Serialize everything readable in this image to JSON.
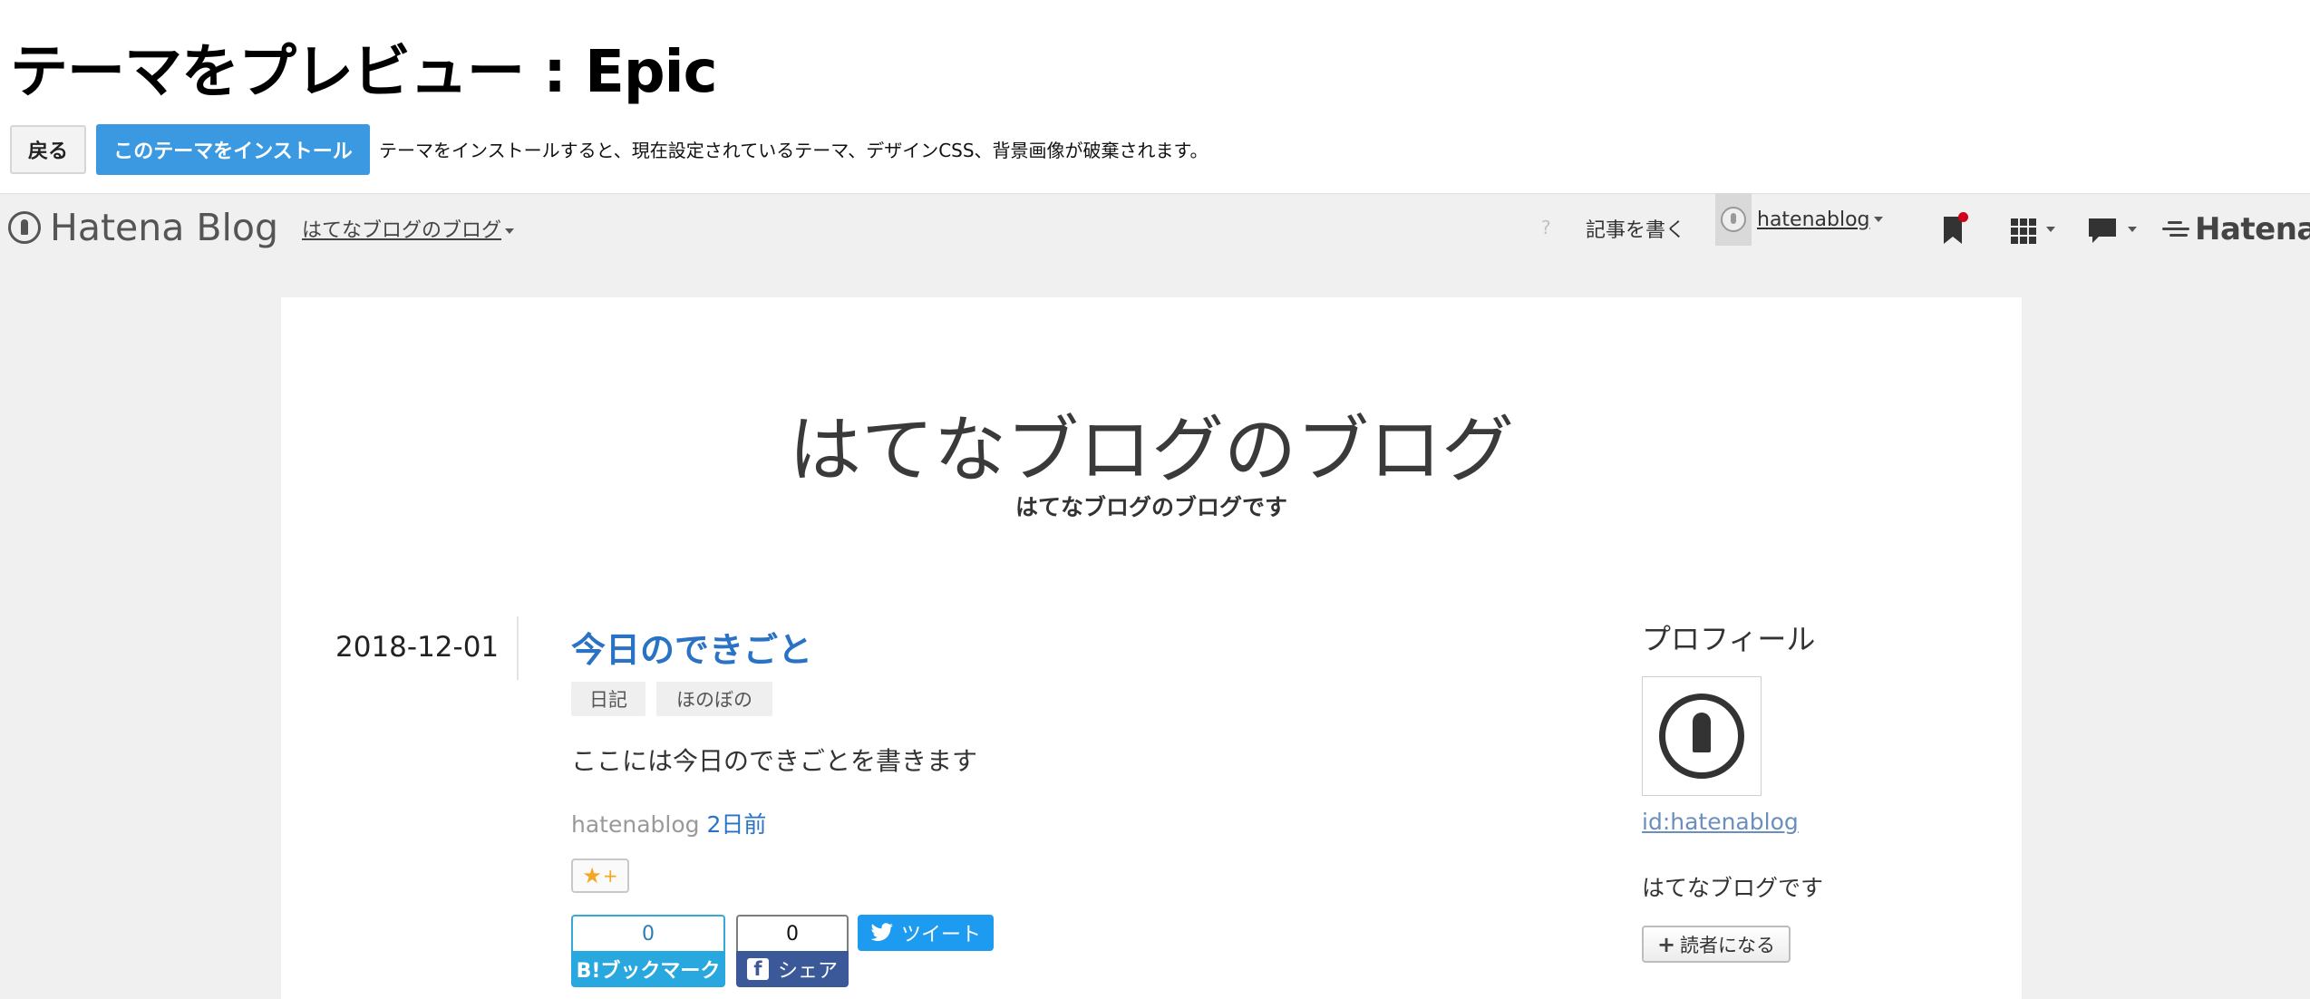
{
  "preview": {
    "title": "テーマをプレビュー : Epic",
    "back_label": "戻る",
    "install_label": "このテーマをインストール",
    "install_note": "テーマをインストールすると、現在設定されているテーマ、デザインCSS、背景画像が破棄されます。"
  },
  "toolbar": {
    "logo_text": "Hatena Blog",
    "blog_menu_label": "はてなブログのブログ",
    "help_label": "?",
    "write_label": "記事を書く",
    "user_name": "hatenablog",
    "brand_text": "Hatena",
    "icons": {
      "logo": "hatena-blog-pen-icon",
      "bookmark": "bookmark-icon",
      "apps": "grid-icon",
      "notifications": "speech-bubble-icon",
      "brand": "hatena-logo-icon"
    },
    "notification_dot_color": "#d0021b"
  },
  "blog": {
    "title": "はてなブログのブログ",
    "description": "はてなブログのブログです"
  },
  "entry": {
    "date": "2018-12-01",
    "title": "今日のできごと",
    "categories": [
      {
        "label": "日記"
      },
      {
        "label": "ほのぼの"
      }
    ],
    "body": "ここには今日のできごとを書きます",
    "author": "hatenablog",
    "time_ago": "2日前",
    "star_glyph": "★",
    "star_plus": "+",
    "share": {
      "hatena_count": "0",
      "hatena_label": "B!ブックマーク",
      "facebook_count": "0",
      "facebook_label": "シェア",
      "facebook_icon": "f",
      "tweet_label": "ツイート"
    }
  },
  "sidebar": {
    "heading": "プロフィール",
    "profile_id": "id:hatenablog",
    "profile_description": "はてなブログです",
    "subscribe_label": "読者になる",
    "subscribe_plus": "+"
  },
  "colors": {
    "accent": "#3a99e0",
    "link": "#2a73c4",
    "hatena_bookmark": "#28a8de",
    "facebook": "#3b5998",
    "twitter": "#1d9bf0"
  }
}
